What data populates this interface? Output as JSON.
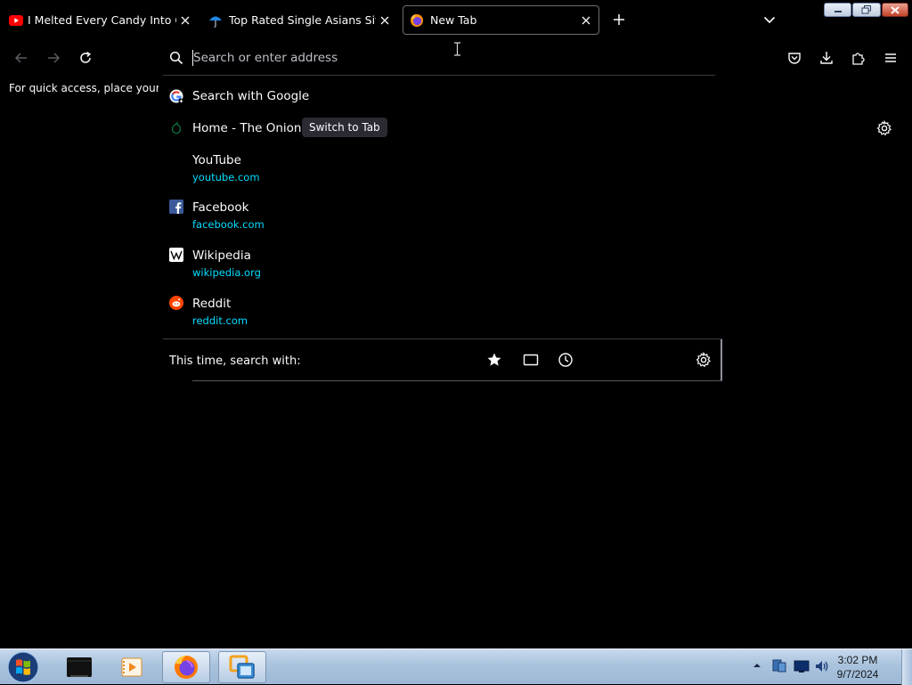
{
  "tabs": [
    {
      "title": "I Melted Every Candy Into One Giant Gummy",
      "icon": "youtube-icon",
      "color": "#ff0000"
    },
    {
      "title": "Top Rated Single Asians Site — Dating",
      "icon": "umbrella-icon",
      "color": "#1e88e5"
    },
    {
      "title": "New Tab",
      "icon": "firefox-icon",
      "active": true
    }
  ],
  "url_bar": {
    "placeholder": "Search or enter address",
    "value": ""
  },
  "new_tab_page": {
    "quick_access_text": "For quick access, place your bookmarks here"
  },
  "suggestions": [
    {
      "title": "Search with Google",
      "url": "",
      "icon": "google-icon"
    },
    {
      "title": "Home - The Onion",
      "url": "",
      "icon": "onion-icon",
      "badge": "Switch to Tab"
    },
    {
      "title": "YouTube",
      "url": "youtube.com",
      "icon": "none"
    },
    {
      "title": "Facebook",
      "url": "facebook.com",
      "icon": "facebook-icon"
    },
    {
      "title": "Wikipedia",
      "url": "wikipedia.org",
      "icon": "wikipedia-icon"
    },
    {
      "title": "Reddit",
      "url": "reddit.com",
      "icon": "reddit-icon"
    }
  ],
  "search_footer": {
    "label": "This time, search with:",
    "engines": [
      "bookmarks-icon",
      "tabs-icon",
      "history-icon"
    ]
  },
  "taskbar": {
    "items": [
      "start-orb",
      "terminal-icon",
      "media-player-icon",
      "firefox-icon",
      "vmware-icon"
    ],
    "clock": {
      "time": "3:02 PM",
      "date": "9/7/2024"
    }
  },
  "colors": {
    "background": "#000000",
    "link": "#00ddff",
    "badge": "#2b2a33"
  }
}
